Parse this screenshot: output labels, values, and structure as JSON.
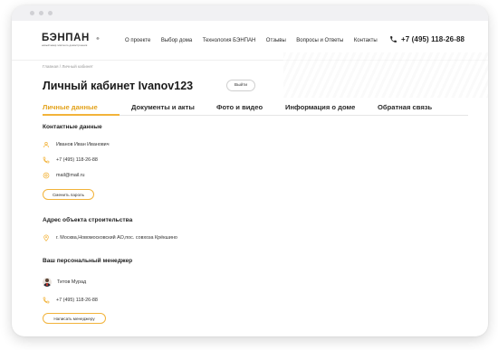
{
  "logo": {
    "name": "БЭНПАН",
    "reg": "®",
    "tagline": "новый жанр элитного домостроения"
  },
  "nav": [
    "О проекте",
    "Выбор дома",
    "Технология БЭНПАН",
    "Отзывы",
    "Вопросы и Ответы",
    "Контакты"
  ],
  "header": {
    "phone": "+7 (495) 118-26-88"
  },
  "breadcrumb": "Главная / Личный кабинет",
  "page": {
    "title": "Личный кабинет Ivanov123",
    "exit_label": "Выйти"
  },
  "tabs": [
    {
      "label": "Личные данные",
      "active": true
    },
    {
      "label": "Документы и акты",
      "active": false
    },
    {
      "label": "Фото и видео",
      "active": false
    },
    {
      "label": "Информация о доме",
      "active": false
    },
    {
      "label": "Обратная связь",
      "active": false
    }
  ],
  "contacts": {
    "title": "Контактные данные",
    "name": "Иванов Иван Иванович",
    "phone": "+7 (495) 118-26-88",
    "email": "mail@mail.ru",
    "change_password_label": "Сменить пароль"
  },
  "address": {
    "title": "Адрес объекта строительства",
    "value": "г. Москва,Новомосковский АО,пос. совхоза Крёкшино"
  },
  "manager": {
    "title": "Ваш персональный менеджер",
    "name": "Титов Мурад",
    "phone": "+7 (495) 118-26-88",
    "write_label": "Написать менеджеру"
  },
  "colors": {
    "accent": "#f2b33a",
    "accent_text": "#e3a21a"
  },
  "icons": {
    "phone": "phone-icon",
    "user": "user-icon",
    "email": "at-icon",
    "location": "location-pin-icon"
  }
}
